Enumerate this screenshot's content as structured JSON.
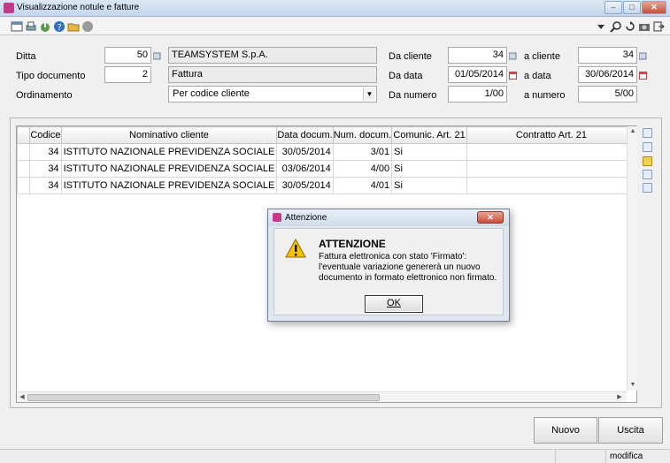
{
  "window": {
    "title": "Visualizzazione notule e fatture",
    "min": "–",
    "max": "□",
    "close": "✕"
  },
  "form": {
    "ditta": {
      "label": "Ditta",
      "code": "50",
      "name": "TEAMSYSTEM S.p.A."
    },
    "tipo_documento": {
      "label": "Tipo documento",
      "code": "2",
      "name": "Fattura"
    },
    "ordinamento": {
      "label": "Ordinamento",
      "value": "Per codice cliente"
    },
    "da_cliente": {
      "label": "Da cliente",
      "value": "34"
    },
    "a_cliente": {
      "label": "a cliente",
      "value": "34"
    },
    "da_data": {
      "label": "Da data",
      "value": "01/05/2014"
    },
    "a_data": {
      "label": "a data",
      "value": "30/06/2014"
    },
    "da_numero": {
      "label": "Da numero",
      "value": "1/00"
    },
    "a_numero": {
      "label": "a numero",
      "value": "5/00"
    }
  },
  "table": {
    "headers": [
      "Codice",
      "Nominativo cliente",
      "Data docum.",
      "Num. docum.",
      "Comunic. Art. 21",
      "Contratto Art. 21"
    ],
    "rows": [
      [
        "34",
        "ISTITUTO NAZIONALE PREVIDENZA SOCIALE",
        "30/05/2014",
        "3/01",
        "Si",
        ""
      ],
      [
        "34",
        "ISTITUTO NAZIONALE PREVIDENZA SOCIALE",
        "03/06/2014",
        "4/00",
        "Si",
        ""
      ],
      [
        "34",
        "ISTITUTO NAZIONALE PREVIDENZA SOCIALE",
        "30/05/2014",
        "4/01",
        "Si",
        ""
      ]
    ]
  },
  "dialog": {
    "title": "Attenzione",
    "heading": "ATTENZIONE",
    "lines": [
      "Fattura elettronica con stato 'Firmato':",
      "l'eventuale variazione genererà un nuovo",
      "documento in formato elettronico non firmato."
    ],
    "ok": "OK",
    "close": "✕"
  },
  "buttons": {
    "nuovo": "Nuovo",
    "uscita": "Uscita"
  },
  "status": {
    "mode": "modifica"
  },
  "colors": {
    "accent": "#c43a8a",
    "warning": "#f5c400"
  }
}
